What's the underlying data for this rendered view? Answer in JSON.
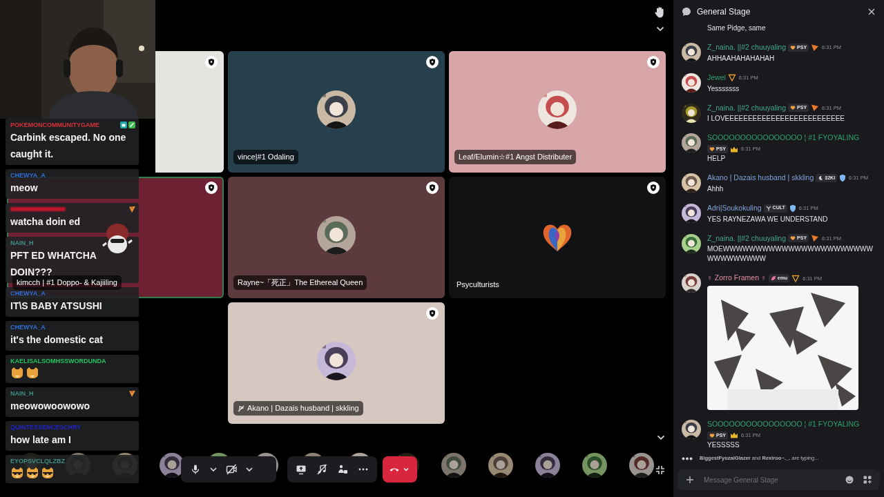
{
  "stage": {
    "tiles": [
      {
        "color": "#e4e4e0",
        "speaking": false,
        "kind": "blank"
      },
      {
        "label": "vince|#1 Odaling",
        "color": "#26404e",
        "speaking": false,
        "kind": "avatar"
      },
      {
        "label": "Leaf/Elumin☆#1 Angst Distributer",
        "color": "#d8a5a8",
        "speaking": false,
        "kind": "avatar"
      },
      {
        "label": "kimcch | #1 Doppo- & Kajiiling",
        "color": "#6e2133",
        "speaking": true,
        "kind": "blank"
      },
      {
        "label": "Rayne~「死正」The Ethereal Queen",
        "color": "#5c3a3e",
        "speaking": false,
        "kind": "avatar"
      },
      {
        "label": "Psyculturists",
        "color": "#111214",
        "speaking": false,
        "kind": "logo"
      },
      {
        "label": "Akano | Dazais husband | skkling",
        "color": "#d6c8c0",
        "speaking": false,
        "kind": "avatar",
        "muted": true
      }
    ],
    "audience": [
      {
        "kind": "picture"
      },
      {
        "kind": "picture"
      },
      {
        "kind": "picture"
      },
      {
        "kind": "picture"
      },
      {
        "kind": "picture"
      },
      {
        "kind": "picture"
      },
      {
        "kind": "picture"
      },
      {
        "kind": "picture"
      },
      {
        "kind": "picture"
      },
      {
        "kind": "picture"
      },
      {
        "kind": "picture"
      },
      {
        "kind": "picture"
      },
      {
        "kind": "picture"
      },
      {
        "kind": "picture"
      }
    ],
    "controls": {
      "camera_on": false
    }
  },
  "stream_overlay": {
    "webcam": {
      "kind": "picture"
    },
    "messages": [
      {
        "user": "POKEMONCOMMUNITYGAME",
        "color": "#d8313a",
        "text": "Carbink escaped. No one caught it.",
        "badges": [
          {
            "kind": "bot"
          },
          {
            "kind": "sword"
          }
        ]
      },
      {
        "user": "CHEWYA_A",
        "color": "#2f6fd8",
        "text": "meow"
      },
      {
        "color": "#c0152a",
        "text": "watcha doin ed",
        "badges": [
          {
            "kind": "pizza"
          }
        ]
      },
      {
        "user": "NAIN_H",
        "color": "#3e8f86",
        "text": "PFT ED WHATCHA DOIN???"
      },
      {
        "user": "CHEWYA_A",
        "color": "#2f6fd8",
        "text": "IT\\S BABY ATSUSHI"
      },
      {
        "user": "CHEWYA_A",
        "color": "#2f6fd8",
        "text": "it's the domestic cat"
      },
      {
        "user": "KAELISALSOMHSSWORDUNDA",
        "color": "#22c55e",
        "emotes": [
          {
            "kind": "cat"
          },
          {
            "kind": "cat"
          }
        ]
      },
      {
        "user": "NAIN_H",
        "color": "#3e8f86",
        "text": "meowowoowowo",
        "badges": [
          {
            "kind": "pizza"
          }
        ]
      },
      {
        "user": "QUINTESSENCESCHRY",
        "color": "#1d24c9",
        "text": "how late am I"
      },
      {
        "user": "EYOPSVCLQLZBZ",
        "color": "#3e8f86",
        "emotes": [
          {
            "kind": "cool-cat"
          },
          {
            "kind": "cool-cat"
          },
          {
            "kind": "cool-cat"
          }
        ]
      }
    ]
  },
  "chat": {
    "title": "General Stage",
    "messages": [
      {
        "text": "Same Pidge, same"
      },
      {
        "author": "Z_naina. ||#2 chuuyaling",
        "color": "#45a88a",
        "badges": [
          {
            "kind": "heart_tag",
            "text": "PSY"
          },
          {
            "kind": "triangle"
          }
        ],
        "time": "6:31 PM",
        "text": "AHHAAHAHAHAHAH"
      },
      {
        "author": "Jewel",
        "color": "#2f9e6e",
        "badges": [
          {
            "kind": "triangle_outline"
          }
        ],
        "time": "6:31 PM",
        "text": "Yesssssss"
      },
      {
        "author": "Z_naina. ||#2 chuuyaling",
        "color": "#45a88a",
        "badges": [
          {
            "kind": "heart_tag",
            "text": "PSY"
          },
          {
            "kind": "triangle"
          }
        ],
        "time": "6:31 PM",
        "text": "I LOVEEEEEEEEEEEEEEEEEEEEEEEEEE"
      },
      {
        "author": "SOOOOOOOOOOOOOOOO ¦ #1 FYOYALING",
        "color": "#2fa36b",
        "badges": [
          {
            "kind": "heart_tag",
            "text": "PSY"
          },
          {
            "kind": "crown"
          }
        ],
        "time": "6:31 PM",
        "text": "HELP"
      },
      {
        "author": "Akano | Dazais husband | skkling",
        "color": "#7fa3d9",
        "badges": [
          {
            "kind": "moon_tag",
            "text": "32KI"
          },
          {
            "kind": "shield"
          }
        ],
        "time": "6:31 PM",
        "text": "Ahhh"
      },
      {
        "author": "Adri|Soukokuling",
        "color": "#7fa3d9",
        "badges": [
          {
            "kind": "fork_tag",
            "text": "CULT"
          },
          {
            "kind": "shield"
          }
        ],
        "time": "6:31 PM",
        "text": "YES RAYNEZAWA WE UNDERSTAND"
      },
      {
        "author": "Z_naina. ||#2 chuuyaling",
        "color": "#45a88a",
        "badges": [
          {
            "kind": "heart_tag",
            "text": "PSY"
          },
          {
            "kind": "triangle"
          }
        ],
        "time": "6:31 PM",
        "text": "MOEWWWWWWWWWWWWWWWWWWWWWWWWWWWWWWWW"
      },
      {
        "author": "♀ Zorro Framen ♀",
        "color": "#e58fa6",
        "badges": [
          {
            "kind": "leaf_tag",
            "text": "emu"
          },
          {
            "kind": "triangle_outline"
          }
        ],
        "time": "6:31 PM",
        "attachment": {
          "kind": "picture"
        }
      },
      {
        "author": "SOOOOOOOOOOOOOOOO ¦ #1 FYOYALING",
        "color": "#2fa36b",
        "badges": [
          {
            "kind": "heart_tag",
            "text": "PSY"
          },
          {
            "kind": "crown"
          }
        ],
        "time": "6:31 PM",
        "text": "YESSSSS"
      }
    ],
    "typing": "**BiggestFyozaiGlazer** and **Rexiroo~._.** are typing...",
    "input": {
      "placeholder": "Message General Stage"
    }
  }
}
